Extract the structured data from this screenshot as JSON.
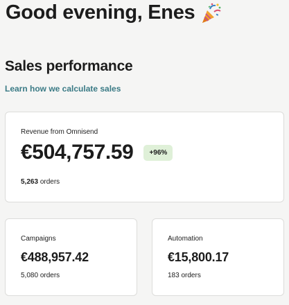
{
  "header": {
    "greeting": "Good evening, Enes",
    "greeting_icon": "party-popper-icon"
  },
  "sales": {
    "title": "Sales performance",
    "learn_link": "Learn how we calculate sales",
    "colors": {
      "link": "#3a7a85",
      "badge_bg": "#dff0d8"
    },
    "total": {
      "label": "Revenue from Omnisend",
      "value": "€504,757.59",
      "change": "+96%",
      "orders_count": "5,263",
      "orders_unit": "orders"
    },
    "campaigns": {
      "label": "Campaigns",
      "value": "€488,957.42",
      "orders_count": "5,080",
      "orders_unit": "orders"
    },
    "automation": {
      "label": "Automation",
      "value": "€15,800.17",
      "orders_count": "183",
      "orders_unit": "orders"
    }
  }
}
